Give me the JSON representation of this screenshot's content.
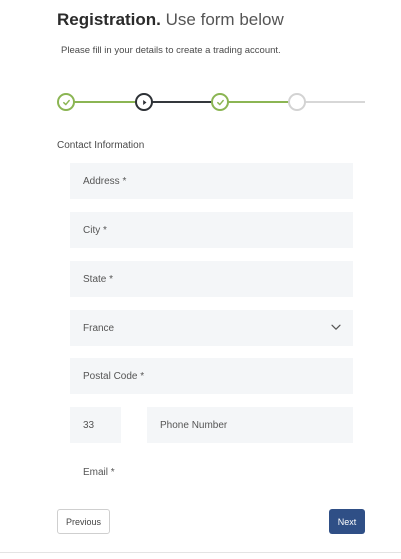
{
  "header": {
    "title_bold": "Registration.",
    "title_light": "Use form below",
    "subtitle": "Please fill in your details to create a trading account."
  },
  "stepper": {
    "steps": [
      {
        "state": "done",
        "icon": "check-icon"
      },
      {
        "state": "current",
        "icon": "play-icon"
      },
      {
        "state": "done",
        "icon": "check-icon"
      },
      {
        "state": "todo",
        "icon": "empty"
      }
    ],
    "colors": {
      "done": "#8bb553",
      "current": "#2d3136",
      "todo": "#d3d3d3"
    }
  },
  "form": {
    "section_label": "Contact Information",
    "address_label": "Address *",
    "city_label": "City *",
    "state_label": "State *",
    "country_value": "France",
    "postal_label": "Postal Code *",
    "phone_code": "33",
    "phone_label": "Phone Number",
    "email_label": "Email *"
  },
  "buttons": {
    "previous_label": "Previous",
    "next_label": "Next",
    "next_color": "#2f4f86"
  }
}
